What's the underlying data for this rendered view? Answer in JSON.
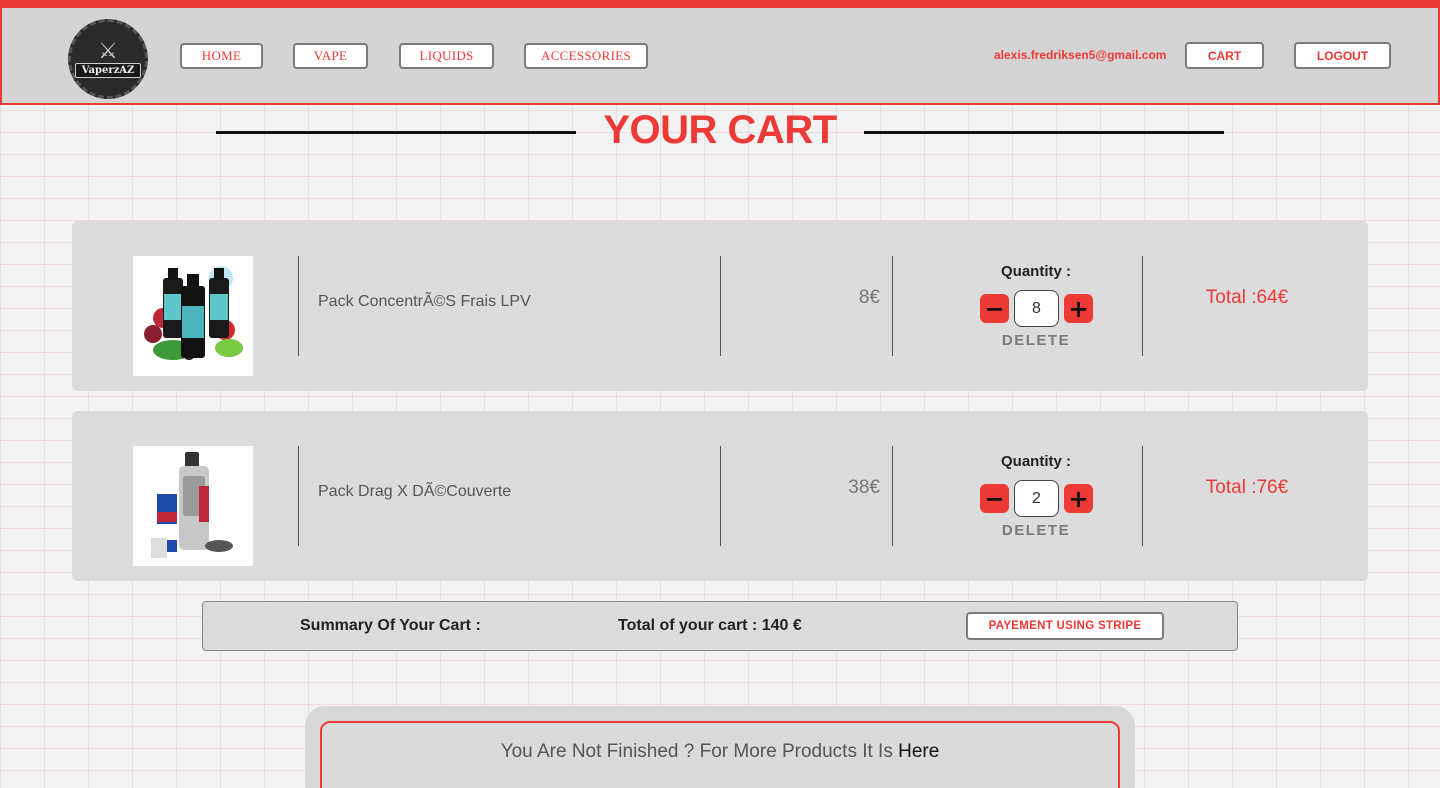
{
  "nav": {
    "logo_text": "VaperzAZ",
    "logo_icon": "crossed-swords-icon",
    "links": [
      "HOME",
      "VAPE",
      "LIQUIDS",
      "ACCESSORIES"
    ],
    "user_email": "alexis.fredriksen5@gmail.com",
    "cart_label": "CART",
    "logout_label": "LOGOUT"
  },
  "page": {
    "title": "YOUR CART"
  },
  "cart": {
    "quantity_label": "Quantity :",
    "delete_label": "DELETE",
    "minus_icon": "minus-icon",
    "plus_icon": "plus-icon",
    "items": [
      {
        "name": "Pack ConcentrÃ©S Frais LPV",
        "price": "8€",
        "quantity": "8",
        "total": "Total :64€"
      },
      {
        "name": "Pack Drag X DÃ©Couverte",
        "price": "38€",
        "quantity": "2",
        "total": "Total :76€"
      }
    ]
  },
  "summary": {
    "label": "Summary Of Your Cart :",
    "total": "Total of your cart : 140 €",
    "pay_label": "PAYEMENT USING STRIPE"
  },
  "more": {
    "text": "You Are Not Finished ? For More Products It Is ",
    "link": "Here"
  },
  "colors": {
    "accent": "#ee3a36",
    "navbar_bg": "#d4d4d4",
    "card_bg": "#dcdcdc"
  }
}
